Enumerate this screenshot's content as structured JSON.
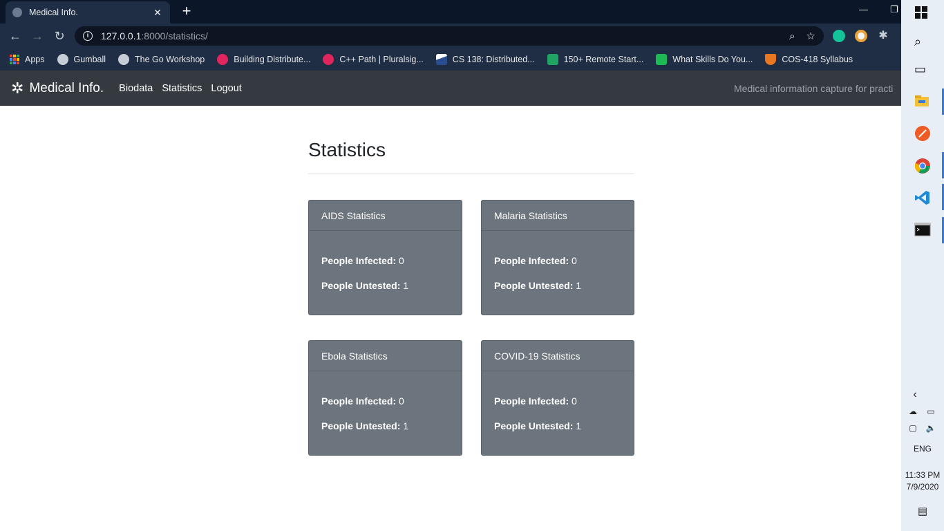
{
  "browser": {
    "tab_title": "Medical Info.",
    "tab_close": "✕",
    "new_tab": "+",
    "url_host": "127.0.0.1",
    "url_path": ":8000/statistics/",
    "bookmarks": [
      {
        "label": "Apps",
        "icon": "apps-grid-icon"
      },
      {
        "label": "Gumball",
        "icon": "globe-icon"
      },
      {
        "label": "The Go Workshop",
        "icon": "globe-icon"
      },
      {
        "label": "Building Distribute...",
        "icon": "pluralsight-icon"
      },
      {
        "label": "C++ Path | Pluralsig...",
        "icon": "pluralsight-icon"
      },
      {
        "label": "CS 138: Distributed...",
        "icon": "course-icon"
      },
      {
        "label": "150+ Remote Start...",
        "icon": "sheet-icon"
      },
      {
        "label": "What Skills Do You...",
        "icon": "power-icon"
      },
      {
        "label": "COS-418 Syllabus",
        "icon": "shield-icon"
      }
    ]
  },
  "site": {
    "brand": "Medical Info.",
    "nav": [
      "Biodata",
      "Statistics",
      "Logout"
    ],
    "tagline": "Medical information capture for practi"
  },
  "page": {
    "title": "Statistics",
    "cards": [
      {
        "title": "AIDS Statistics",
        "infected_label": "People Infected:",
        "infected": "0",
        "untested_label": "People Untested:",
        "untested": "1"
      },
      {
        "title": "Malaria Statistics",
        "infected_label": "People Infected:",
        "infected": "0",
        "untested_label": "People Untested:",
        "untested": "1"
      },
      {
        "title": "Ebola Statistics",
        "infected_label": "People Infected:",
        "infected": "0",
        "untested_label": "People Untested:",
        "untested": "1"
      },
      {
        "title": "COVID-19 Statistics",
        "infected_label": "People Infected:",
        "infected": "0",
        "untested_label": "People Untested:",
        "untested": "1"
      }
    ]
  },
  "taskbar": {
    "language": "ENG",
    "time": "11:33 PM",
    "date": "7/9/2020"
  },
  "colors": {
    "navbar": "#343a40",
    "card": "#6c757d",
    "browser_bg": "#1f2e44"
  }
}
